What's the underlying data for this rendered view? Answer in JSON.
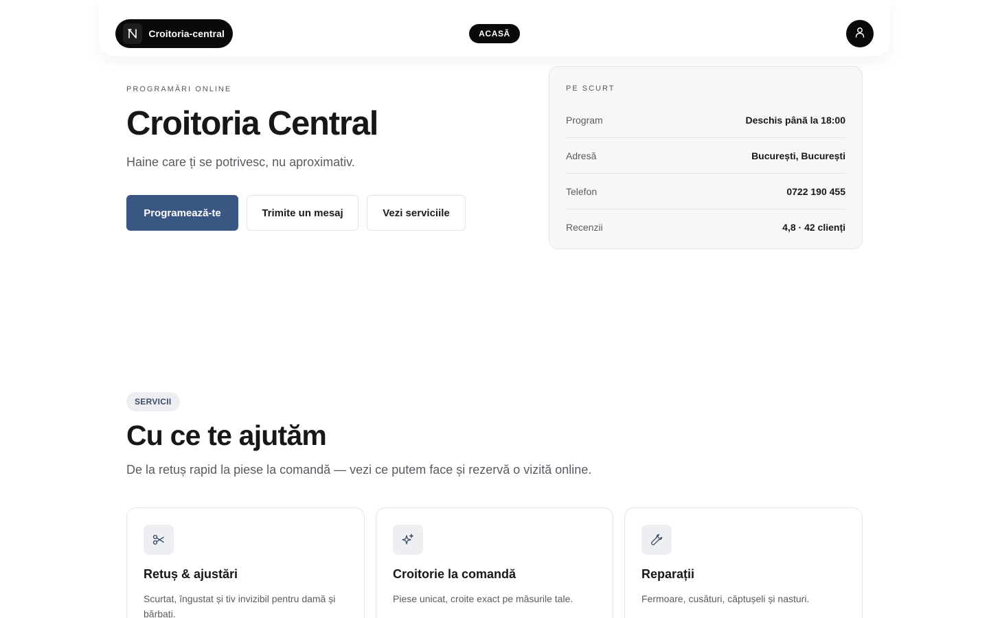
{
  "header": {
    "brand_name": "Croitoria-central",
    "nav_home": "ACASĂ"
  },
  "hero": {
    "eyebrow": "PROGRAMĂRI ONLINE",
    "title": "Croitoria Central",
    "subtitle": "Haine care ți se potrivesc, nu aproximativ.",
    "cta_primary": "Programează-te",
    "cta_message": "Trimite un mesaj",
    "cta_services": "Vezi serviciile"
  },
  "info": {
    "eyebrow": "PE SCURT",
    "rows": [
      {
        "label": "Program",
        "value": "Deschis până la 18:00"
      },
      {
        "label": "Adresă",
        "value": "București, București"
      },
      {
        "label": "Telefon",
        "value": "0722 190 455"
      },
      {
        "label": "Recenzii",
        "value": "4,8 · 42 clienți"
      }
    ]
  },
  "services": {
    "badge": "SERVICII",
    "title": "Cu ce te ajutăm",
    "subtitle": "De la retuș rapid la piese la comandă — vezi ce putem face și rezervă o vizită online.",
    "cards": [
      {
        "icon": "scissors-icon",
        "title": "Retuș & ajustări",
        "desc": "Scurtat, îngustat și tiv invizibil pentru damă și bărbați."
      },
      {
        "icon": "sparkles-icon",
        "title": "Croitorie la comandă",
        "desc": "Piese unicat, croite exact pe măsurile tale."
      },
      {
        "icon": "wrench-icon",
        "title": "Reparații",
        "desc": "Fermoare, cusături, căptușeli și nasturi."
      }
    ]
  },
  "colors": {
    "primary": "#3a5683",
    "dark": "#0a0a0a",
    "muted_text": "#5a5a60",
    "card_bg": "#f7f7f6"
  }
}
